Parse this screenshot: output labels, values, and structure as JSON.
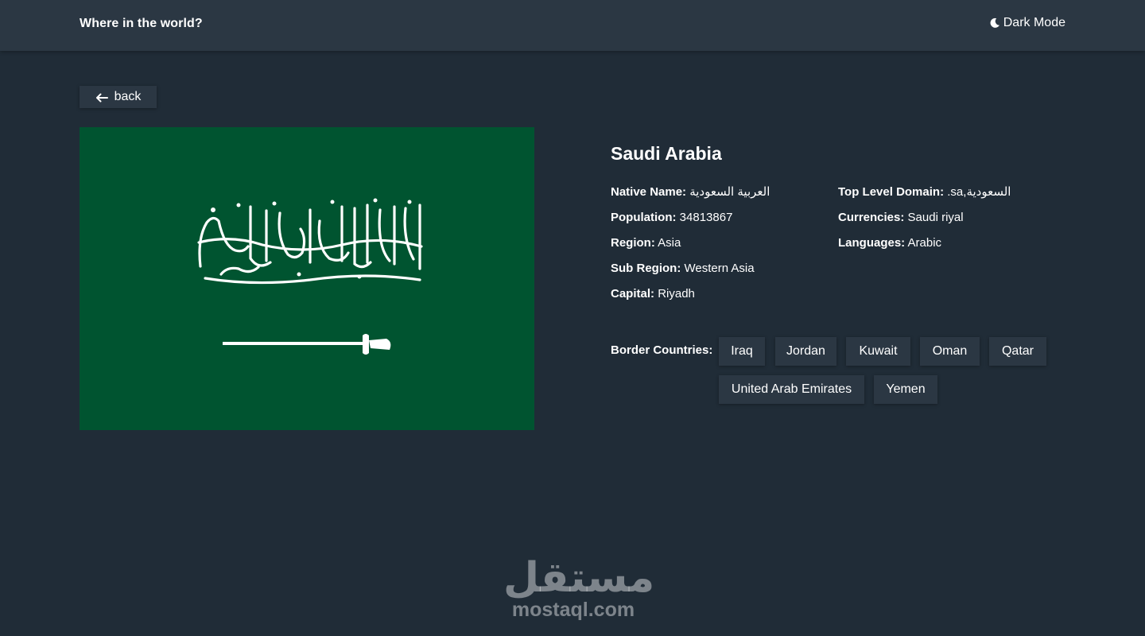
{
  "header": {
    "title": "Where in the world?",
    "mode_label": "Dark Mode"
  },
  "back_button": {
    "label": "back"
  },
  "country": {
    "name": "Saudi Arabia",
    "flag_colors": {
      "field": "#005430",
      "emblem": "#ffffff"
    },
    "left_details": [
      {
        "key": "Native Name:",
        "value": "العربية السعودية"
      },
      {
        "key": "Population:",
        "value": "34813867"
      },
      {
        "key": "Region:",
        "value": "Asia"
      },
      {
        "key": "Sub Region:",
        "value": "Western Asia"
      },
      {
        "key": "Capital:",
        "value": "Riyadh"
      }
    ],
    "right_details": [
      {
        "key": "Top Level Domain:",
        "value": ".sa,السعودية"
      },
      {
        "key": "Currencies:",
        "value": "Saudi riyal"
      },
      {
        "key": "Languages:",
        "value": "Arabic"
      }
    ],
    "border_label": "Border Countries:",
    "border_countries": [
      "Iraq",
      "Jordan",
      "Kuwait",
      "Oman",
      "Qatar",
      "United Arab Emirates",
      "Yemen"
    ]
  },
  "watermark": {
    "arabic": "مستقل",
    "latin": "mostaql.com"
  },
  "colors": {
    "background": "#202c37",
    "elements": "#2b3743",
    "text": "#ffffff"
  }
}
